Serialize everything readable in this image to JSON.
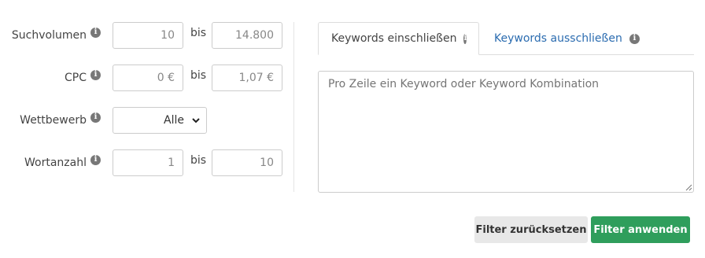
{
  "filters": {
    "suchvolumen": {
      "label": "Suchvolumen",
      "from": "10",
      "bis": "bis",
      "to": "14.800"
    },
    "cpc": {
      "label": "CPC",
      "from": "0 €",
      "bis": "bis",
      "to": "1,07 €"
    },
    "wettbewerb": {
      "label": "Wettbewerb",
      "selected": "Alle"
    },
    "wortanzahl": {
      "label": "Wortanzahl",
      "from": "1",
      "bis": "bis",
      "to": "10"
    }
  },
  "keywords": {
    "tabs": [
      {
        "label": "Keywords einschließen",
        "active": true
      },
      {
        "label": "Keywords ausschließen",
        "active": false
      }
    ],
    "placeholder": "Pro Zeile ein Keyword oder Keyword Kombination"
  },
  "buttons": {
    "reset_label": "Filter zurücksetzen",
    "apply_label": "Filter anwenden"
  },
  "colors": {
    "apply_bg": "#2f9e5c",
    "tab_link": "#2b6cb0",
    "reset_bg": "#e8e8e8"
  },
  "icons": {
    "info": "info-icon",
    "select": "chevron-down-icon"
  }
}
